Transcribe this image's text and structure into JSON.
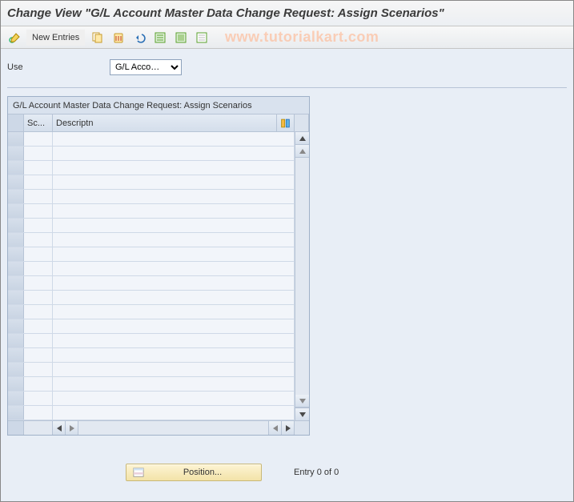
{
  "title": "Change View \"G/L Account Master Data Change Request: Assign Scenarios\"",
  "toolbar": {
    "new_entries_label": "New Entries"
  },
  "watermark": "www.tutorialkart.com",
  "field": {
    "use_label": "Use",
    "use_value": "G/L Acco…"
  },
  "table": {
    "caption": "G/L Account Master Data Change Request: Assign Scenarios",
    "columns": {
      "scenario": "Sc...",
      "description": "Descriptn"
    },
    "row_count": 20
  },
  "footer": {
    "position_label": "Position...",
    "entry_text": "Entry 0 of 0"
  }
}
